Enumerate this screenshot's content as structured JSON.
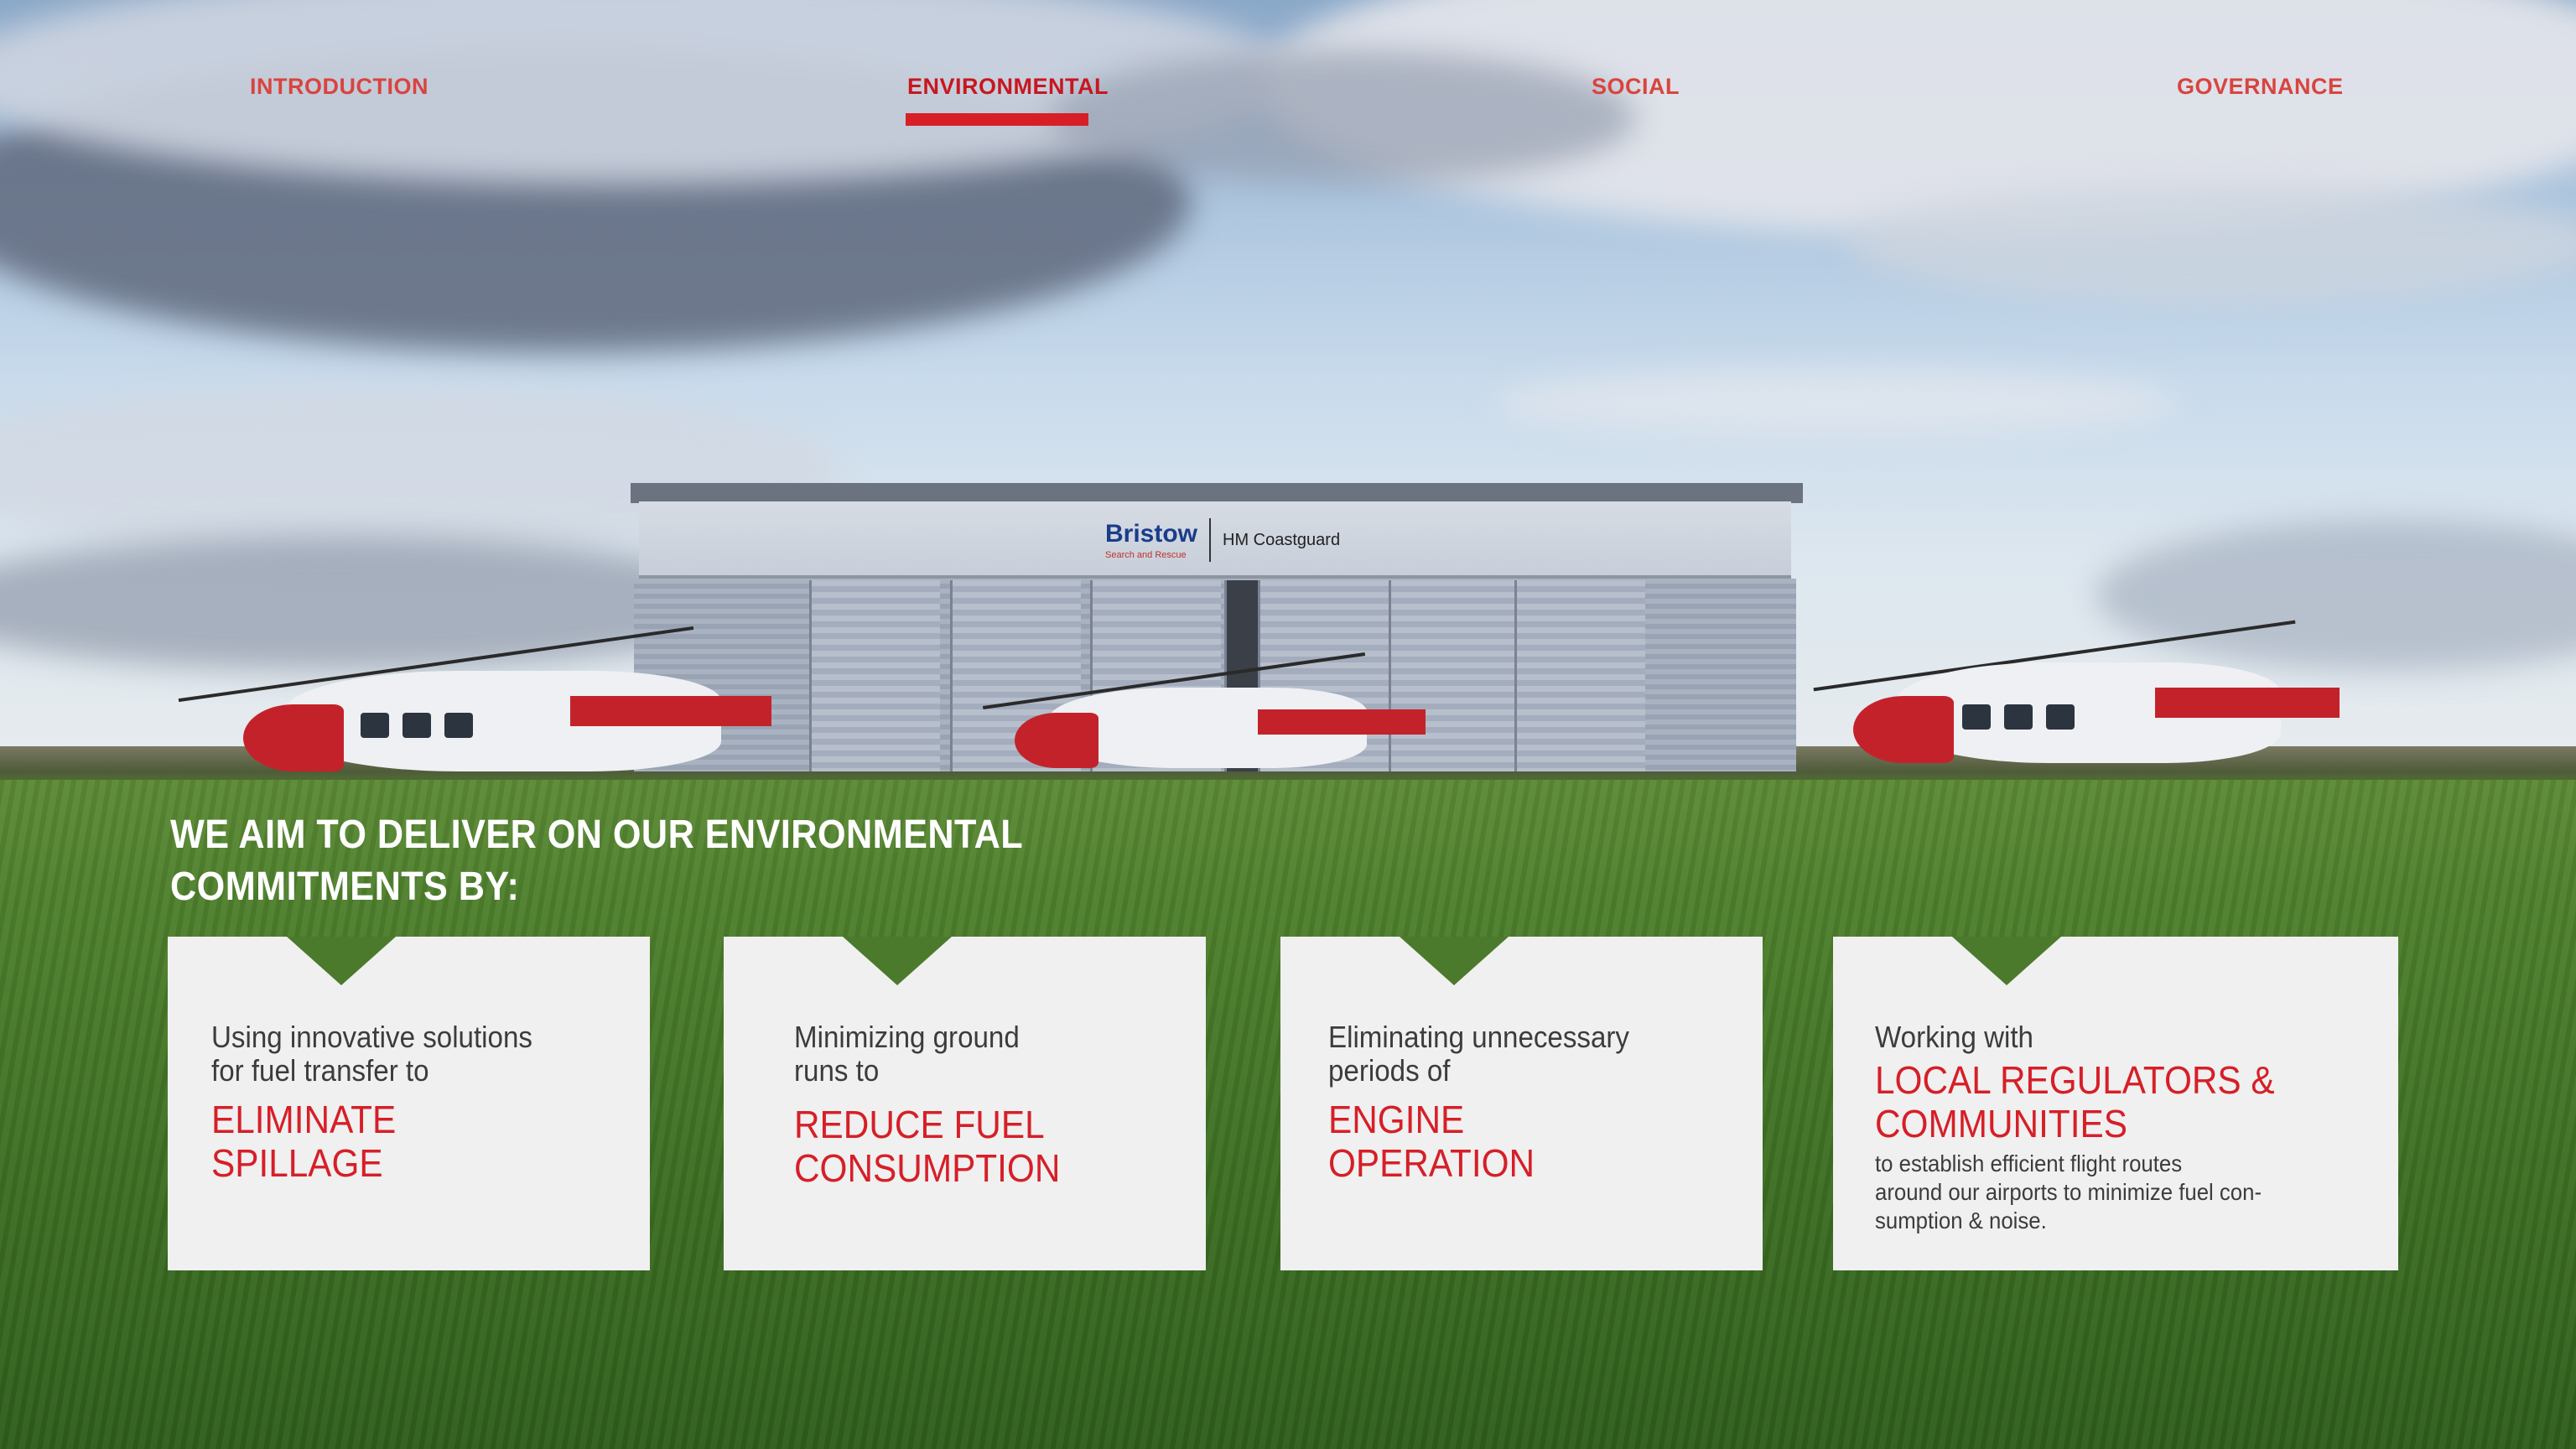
{
  "nav": {
    "items": [
      {
        "label": "INTRODUCTION"
      },
      {
        "label": "ENVIRONMENTAL",
        "active": true
      },
      {
        "label": "SOCIAL"
      },
      {
        "label": "GOVERNANCE"
      }
    ]
  },
  "hangar": {
    "logo_bristow": "Bristow",
    "logo_bristow_sub": "Search and Rescue",
    "logo_hmc": "HM Coastguard"
  },
  "heading": "WE AIM TO DELIVER ON OUR ENVIRONMENTAL COMMITMENTS BY:",
  "cards": [
    {
      "intro": "Using innovative solutions\nfor fuel transfer to",
      "key": "ELIMINATE\nSPILLAGE"
    },
    {
      "intro": "Minimizing ground\nruns to",
      "key": "REDUCE FUEL\nCONSUMPTION"
    },
    {
      "intro": "Eliminating unnecessary\nperiods of",
      "key": "ENGINE\nOPERATION"
    },
    {
      "intro": "Working with",
      "key": "LOCAL REGULATORS &\nCOMMUNITIES",
      "note": "to establish efficient flight routes\naround our airports to minimize fuel con-\nsumption & noise."
    }
  ],
  "colors": {
    "accent_red": "#d61f28",
    "nav_red": "#d9443f",
    "card_bg": "#f0f0f0",
    "heading_white": "#ffffff"
  }
}
